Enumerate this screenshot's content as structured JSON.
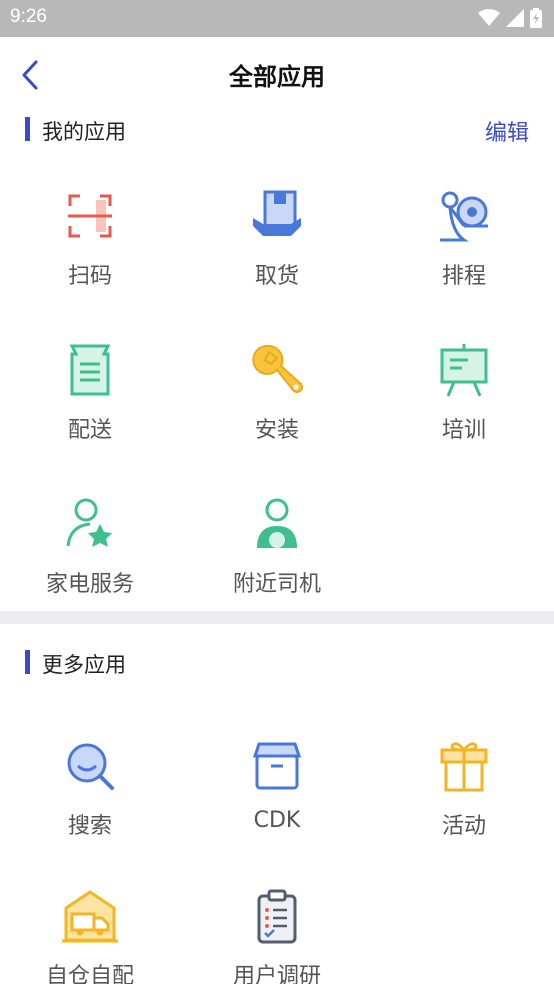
{
  "status": {
    "time": "9:26"
  },
  "header": {
    "title": "全部应用"
  },
  "my_apps": {
    "title": "我的应用",
    "edit_label": "编辑",
    "items": [
      {
        "label": "扫码",
        "icon": "scan-icon"
      },
      {
        "label": "取货",
        "icon": "package-pickup-icon"
      },
      {
        "label": "排程",
        "icon": "route-schedule-icon"
      },
      {
        "label": "配送",
        "icon": "delivery-document-icon"
      },
      {
        "label": "安装",
        "icon": "wrench-icon"
      },
      {
        "label": "培训",
        "icon": "training-board-icon"
      },
      {
        "label": "家电服务",
        "icon": "user-star-icon"
      },
      {
        "label": "附近司机",
        "icon": "driver-icon"
      }
    ]
  },
  "more_apps": {
    "title": "更多应用",
    "items": [
      {
        "label": "搜索",
        "icon": "search-icon"
      },
      {
        "label": "CDK",
        "icon": "box-icon"
      },
      {
        "label": "活动",
        "icon": "gift-icon"
      },
      {
        "label": "自仓自配",
        "icon": "warehouse-truck-icon"
      },
      {
        "label": "用户调研",
        "icon": "clipboard-survey-icon"
      }
    ]
  },
  "colors": {
    "accent": "#3a4bc6",
    "status_bar": "#b8b8b8"
  }
}
